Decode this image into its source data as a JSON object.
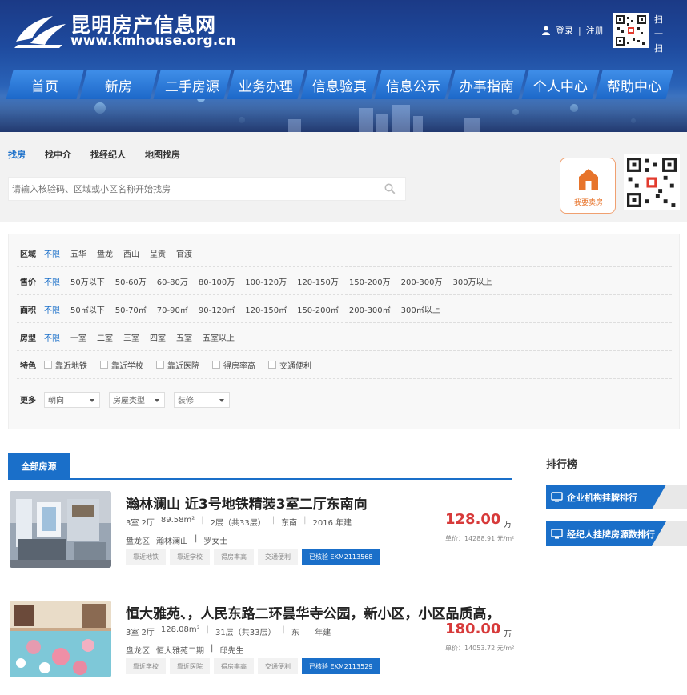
{
  "header": {
    "site_title": "昆明房产信息网",
    "site_url": "www.kmhouse.org.cn",
    "login": "登录",
    "separator": "|",
    "register": "注册",
    "scan_text": "扫一扫"
  },
  "nav": {
    "items": [
      "首页",
      "新房",
      "二手房源",
      "业务办理",
      "信息验真",
      "信息公示",
      "办事指南",
      "个人中心",
      "帮助中心"
    ]
  },
  "search": {
    "tabs": [
      "找房",
      "找中介",
      "找经纪人",
      "地图找房"
    ],
    "active_tab": "找房",
    "placeholder": "请输入核验码、区域或小区名称开始找房",
    "sell_button": "我要卖房"
  },
  "filters": {
    "district": {
      "label": "区域",
      "options": [
        "不限",
        "五华",
        "盘龙",
        "西山",
        "呈贡",
        "官渡"
      ]
    },
    "price": {
      "label": "售价",
      "options": [
        "不限",
        "50万以下",
        "50-60万",
        "60-80万",
        "80-100万",
        "100-120万",
        "120-150万",
        "150-200万",
        "200-300万",
        "300万以上"
      ]
    },
    "area": {
      "label": "面积",
      "options": [
        "不限",
        "50㎡以下",
        "50-70㎡",
        "70-90㎡",
        "90-120㎡",
        "120-150㎡",
        "150-200㎡",
        "200-300㎡",
        "300㎡以上"
      ]
    },
    "rooms": {
      "label": "房型",
      "options": [
        "不限",
        "一室",
        "二室",
        "三室",
        "四室",
        "五室",
        "五室以上"
      ]
    },
    "features": {
      "label": "特色",
      "options": [
        "靠近地铁",
        "靠近学校",
        "靠近医院",
        "得房率高",
        "交通便利"
      ]
    },
    "more": {
      "label": "更多",
      "selects": [
        "朝向",
        "房屋类型",
        "装修"
      ]
    }
  },
  "listings_tab": "全部房源",
  "listings": [
    {
      "title": "瀚林澜山 近3号地铁精装3室二厅东南向",
      "layout": "3室 2厅",
      "area": "89.58m²",
      "floor": "2层（共33层）",
      "orientation": "东南",
      "year": "2016 年建",
      "district": "盘龙区",
      "community": "瀚林澜山",
      "agent": "罗女士",
      "tags": [
        "靠近地铁",
        "靠近学校",
        "得房率高",
        "交通便利"
      ],
      "verified": "已核验 EKM2113568",
      "price": "128.00",
      "price_unit": "万",
      "unit_price": "单价：14288.91 元/m²"
    },
    {
      "title": "恒大雅苑、，人民东路二环昙华寺公园，新小区，小区品质高，",
      "layout": "3室 2厅",
      "area": "128.08m²",
      "floor": "31层（共33层）",
      "orientation": "东",
      "year": "年建",
      "district": "盘龙区",
      "community": "恒大雅苑二期",
      "agent": "邱先生",
      "tags": [
        "靠近学校",
        "靠近医院",
        "得房率高",
        "交通便利"
      ],
      "verified": "已核验 EKM2113529",
      "price": "180.00",
      "price_unit": "万",
      "unit_price": "单价：14053.72 元/m²"
    }
  ],
  "ranking": {
    "title": "排行榜",
    "items": [
      "企业机构挂牌排行",
      "经纪人挂牌房源数排行"
    ]
  },
  "colors": {
    "primary": "#1a6fc9",
    "price": "#d73a3a",
    "sell": "#e7742b"
  }
}
